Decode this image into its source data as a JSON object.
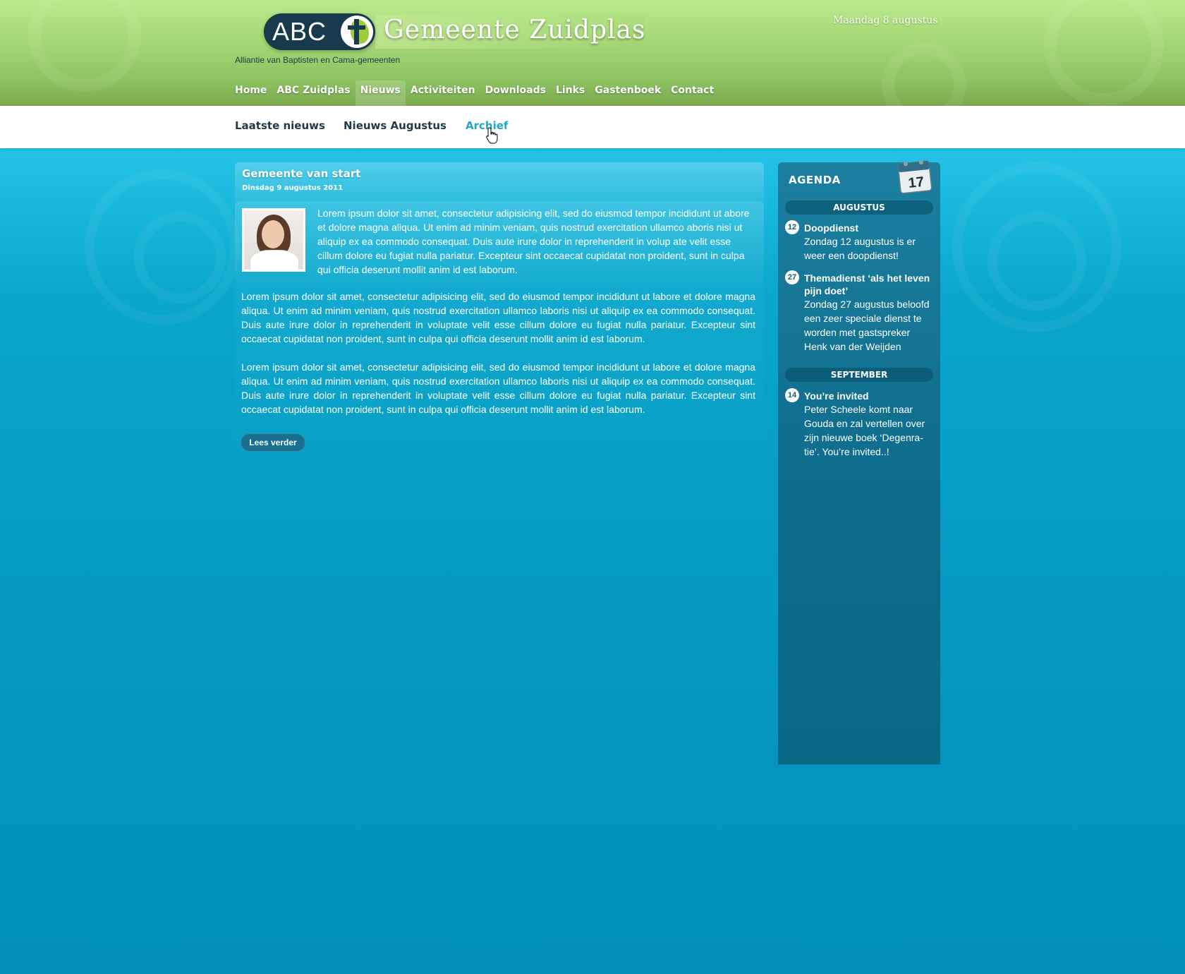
{
  "header": {
    "logo_text": "ABC",
    "site_title": "Gemeente Zuidplas",
    "tagline": "Alliantie van Baptisten en Cama-gemeenten",
    "date": "Maandag 8 augustus"
  },
  "main_nav": {
    "items": [
      {
        "label": "Home"
      },
      {
        "label": "ABC Zuidplas"
      },
      {
        "label": "Nieuws",
        "active": true
      },
      {
        "label": "Activiteiten"
      },
      {
        "label": "Downloads"
      },
      {
        "label": "Links"
      },
      {
        "label": "Gastenboek"
      },
      {
        "label": "Contact"
      }
    ]
  },
  "sub_nav": {
    "items": [
      {
        "label": "Laatste nieuws"
      },
      {
        "label": "Nieuws Augustus"
      },
      {
        "label": "Archief",
        "active": true
      }
    ]
  },
  "article": {
    "title": "Gemeente van start",
    "date": "Dinsdag 9 augustus 2011",
    "paragraphs": [
      "Lorem ipsum dolor sit amet, consectetur adipisicing elit, sed do eiusmod tempor incididunt ut abore et dolore magna aliqua. Ut enim ad minim veniam, quis nostrud exercitation ullamco aboris nisi ut aliquip ex ea commodo consequat. Duis aute irure dolor in reprehenderit in volup ate velit esse cillum dolore eu fugiat nulla pariatur. Excepteur sint occaecat cupidatat non proident, sunt in culpa qui officia deserunt mollit anim id est laborum.",
      "Lorem ipsum dolor sit amet, consectetur adipisicing elit, sed do eiusmod tempor incididunt ut labore et dolore magna aliqua. Ut enim ad minim veniam, quis nostrud exercitation ullamco laboris nisi ut aliquip ex ea commodo consequat. Duis aute irure dolor in reprehenderit in voluptate velit esse cillum dolore eu fugiat nulla pariatur. Excepteur sint occaecat cupidatat non proident, sunt in culpa qui officia deserunt mollit anim id est laborum.",
      "Lorem ipsum dolor sit amet, consectetur adipisicing elit, sed do eiusmod tempor incididunt ut labore et dolore magna aliqua. Ut enim ad minim veniam, quis nostrud exercitation ullamco laboris nisi ut aliquip ex ea commodo consequat. Duis aute irure dolor in reprehenderit in voluptate velit esse cillum dolore eu fugiat nulla pariatur. Excepteur sint occaecat cupidatat non proident, sunt in culpa qui officia deserunt mollit anim id est laborum."
    ],
    "read_more": "Lees verder"
  },
  "agenda": {
    "title": "AGENDA",
    "calendar_day": "17",
    "months": [
      {
        "name": "AUGUSTUS",
        "events": [
          {
            "day": "12",
            "title": "Doopdienst",
            "text": "Zondag 12 augustus is er weer een doopdienst!"
          },
          {
            "day": "27",
            "title": "Themadienst ‘als het leven pijn doet’",
            "text": "Zondag 27 augustus beloofd een zeer speciale dienst te worden met gastspreker Henk van der Weijden"
          }
        ]
      },
      {
        "name": "SEPTEMBER",
        "events": [
          {
            "day": "14",
            "title": "You’re invited",
            "text": "Peter Scheele komt naar Gouda en zal vertellen over zijn nieuwe boek ‘Degenra-tie’. You’re invited..!"
          }
        ]
      }
    ]
  },
  "colors": {
    "header_green": "#9fd272",
    "body_blue": "#0598c0",
    "agenda_blue": "#0f6d8d",
    "active_link": "#20a7c9",
    "logo_navy": "#173a4c"
  },
  "icons": [
    "cross-emblem-icon",
    "calendar-icon",
    "hand-cursor-icon"
  ]
}
